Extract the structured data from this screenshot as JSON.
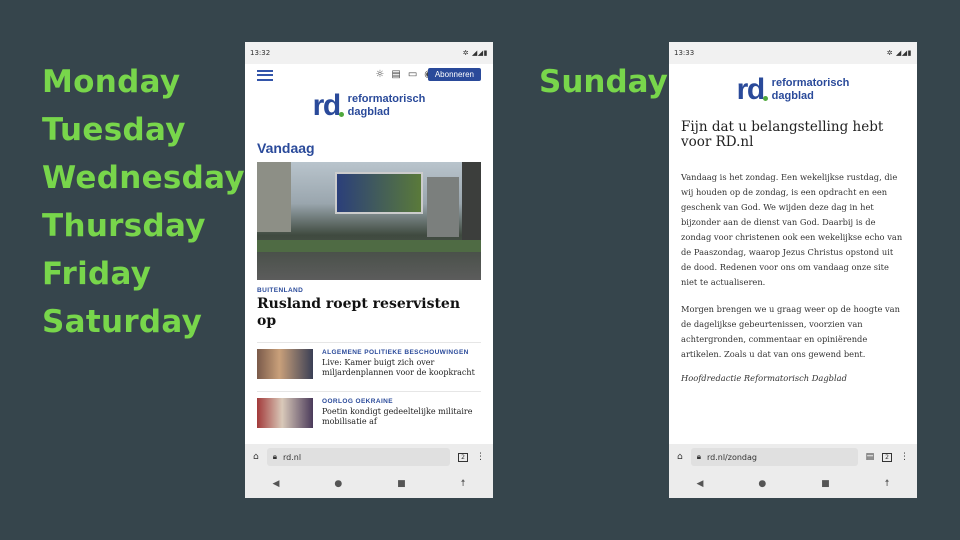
{
  "days": [
    "Monday",
    "Tuesday",
    "Wednesday",
    "Thursday",
    "Friday",
    "Saturday"
  ],
  "sunday": "Sunday",
  "colors": {
    "label_green": "#78d64b",
    "background": "#36454c",
    "brand_blue": "#2a4a9a"
  },
  "phone1": {
    "time": "13:32",
    "subscribe": "Abonneren",
    "logo_rd": "rd",
    "logo_name1": "reformatorisch",
    "logo_name2": "dagblad",
    "section": "Vandaag",
    "hero_category": "BUITENLAND",
    "hero_headline": "Rusland roept reservisten op",
    "items": [
      {
        "category": "ALGEMENE POLITIEKE BESCHOUWINGEN",
        "title": "Live: Kamer buigt zich over miljardenplannen voor de koopkracht"
      },
      {
        "category": "OORLOG OEKRAINE",
        "title": "Poetin kondigt gedeeltelijke militaire mobilisatie af"
      }
    ],
    "url": "rd.nl",
    "tab_count": "2"
  },
  "phone2": {
    "time": "13:33",
    "logo_rd": "rd",
    "logo_name1": "reformatorisch",
    "logo_name2": "dagblad",
    "intro": "Fijn dat u belangstelling hebt voor RD.nl",
    "para1": "Vandaag is het zondag. Een wekelijkse rustdag, die wij houden op de zondag, is een opdracht en een geschenk van God. We wijden deze dag in het bijzonder aan de dienst van God. Daarbij is de zondag voor christenen ook een wekelijkse echo van de Paaszondag, waarop Jezus Christus opstond uit de dood. Redenen voor ons om vandaag onze site niet te actualiseren.",
    "para2": "Morgen brengen we u graag weer op de hoogte van de dagelijkse gebeurtenissen, voorzien van achtergronden, commentaar en opiniërende artikelen. Zoals u dat van ons gewend bent.",
    "signature": "Hoofdredactie Reformatorisch Dagblad",
    "url": "rd.nl/zondag",
    "tab_count": "2"
  }
}
